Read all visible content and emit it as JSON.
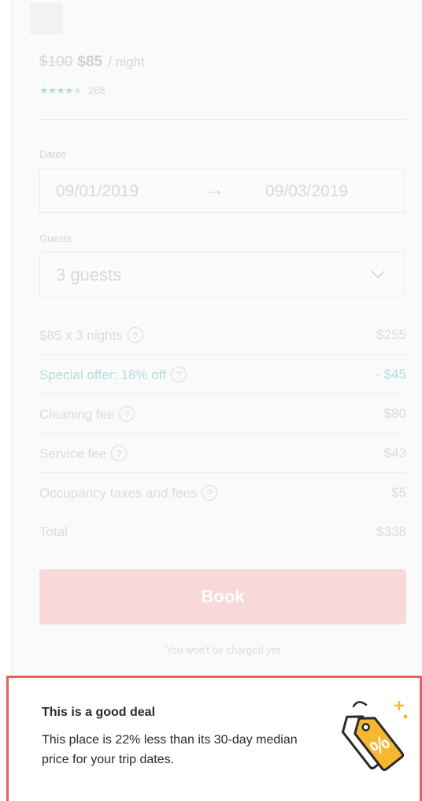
{
  "listing": {
    "price_original": "$100",
    "price_current": "$85",
    "price_unit": "/ night",
    "stars_filled": "★★★★",
    "stars_empty": "★",
    "rating_value": 4,
    "review_count": "268"
  },
  "dates": {
    "label": "Dates",
    "check_in": "09/01/2019",
    "arrow": "→",
    "check_out": "09/03/2019"
  },
  "guests": {
    "label": "Guests",
    "value": "3 guests"
  },
  "breakdown": {
    "help_glyph": "?",
    "nightly": {
      "label": "$85 x 3 nights",
      "amount": "$255"
    },
    "special_offer": {
      "label": "Special offer: 18% off",
      "amount": "- $45"
    },
    "cleaning": {
      "label": "Cleaning fee",
      "amount": "$80"
    },
    "service": {
      "label": "Service fee",
      "amount": "$43"
    },
    "taxes": {
      "label": "Occupancy taxes and fees",
      "amount": "$5"
    },
    "total": {
      "label": "Total",
      "amount": "$338"
    }
  },
  "book": {
    "label": "Book",
    "note": "You won't be charged yet"
  },
  "deal": {
    "title": "This is a good deal",
    "body": "This place is 22% less than its 30-day median price for your trip dates.",
    "icon_name": "discount-tag-icon",
    "icon_text": "%"
  },
  "colors": {
    "accent_red": "#e85f60",
    "book_button": "#f7d9d9",
    "tag_fill": "#f5b82e",
    "special_offer_teal": "#b6dcdc"
  }
}
